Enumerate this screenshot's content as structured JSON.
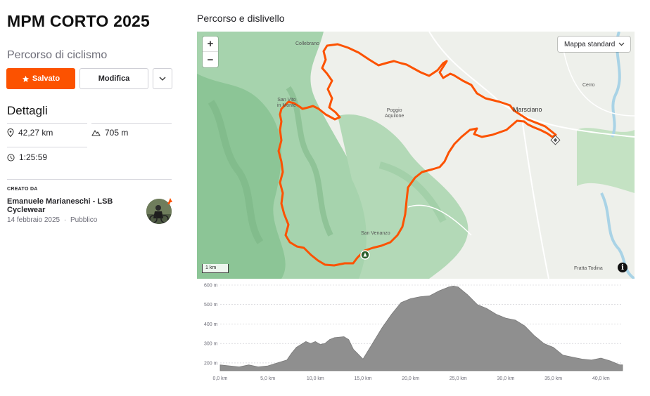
{
  "route": {
    "title": "MPM CORTO 2025",
    "subtitle": "Percorso di ciclismo"
  },
  "actions": {
    "saved_label": "Salvato",
    "edit_label": "Modifica",
    "more_icon": "chevron-down-icon",
    "saved_icon": "star-icon"
  },
  "details": {
    "heading": "Dettagli",
    "distance": "42,27 km",
    "elevation": "705 m",
    "duration": "1:25:59",
    "icons": [
      "location-pin-icon",
      "mountain-icon",
      "clock-icon"
    ]
  },
  "creator": {
    "label": "CREATO DA",
    "name": "Emanuele Marianeschi - LSB Cyclewear",
    "date": "14 febbraio 2025",
    "separator": "·",
    "visibility": "Pubblico"
  },
  "map": {
    "heading": "Percorso e dislivello",
    "zoom_in": "+",
    "zoom_out": "−",
    "map_type": "Mappa standard",
    "scale": "1 km",
    "info": "i",
    "labels": {
      "collebrano": "Collebrano",
      "san_vito": "San Vito\nin Monte",
      "poggio": "Poggio\nAquilone",
      "marsciano": "Marsciano",
      "cerro": "Cerro",
      "san_venanzo": "San Venanzo",
      "fratta": "Fratta Todina"
    },
    "colors": {
      "route": "#fc5200",
      "accent": "#fc5200",
      "forest": "#8fc79a",
      "land": "#eef0eb",
      "water": "#a9d3e6"
    }
  },
  "chart_data": {
    "type": "area",
    "title": "",
    "xlabel": "",
    "ylabel": "",
    "x_ticks": [
      "0,0 km",
      "5,0 km",
      "10,0 km",
      "15,0 km",
      "20,0 km",
      "25,0 km",
      "30,0 km",
      "35,0 km",
      "40,0 km"
    ],
    "y_ticks": [
      "200 m",
      "300 m",
      "400 m",
      "500 m",
      "600 m"
    ],
    "xlim": [
      0,
      42.27
    ],
    "ylim": [
      160,
      600
    ],
    "grid": true,
    "x": [
      0,
      1,
      2,
      3,
      4,
      5,
      6,
      7,
      7.5,
      8,
      9,
      9.5,
      10,
      10.5,
      11,
      11.5,
      12,
      13,
      13.5,
      14,
      15,
      16,
      17,
      18,
      19,
      20,
      21,
      22,
      23,
      24,
      24.5,
      25,
      26,
      27,
      28,
      29,
      30,
      31,
      32,
      33,
      34,
      35,
      36,
      37,
      38,
      39,
      40,
      41,
      42,
      42.27
    ],
    "values": [
      190,
      185,
      180,
      190,
      180,
      185,
      200,
      215,
      250,
      280,
      310,
      300,
      310,
      295,
      300,
      320,
      330,
      335,
      320,
      270,
      220,
      300,
      380,
      450,
      510,
      530,
      540,
      545,
      570,
      590,
      595,
      590,
      550,
      500,
      480,
      450,
      430,
      420,
      390,
      340,
      300,
      280,
      240,
      230,
      220,
      215,
      225,
      210,
      190,
      190
    ]
  }
}
